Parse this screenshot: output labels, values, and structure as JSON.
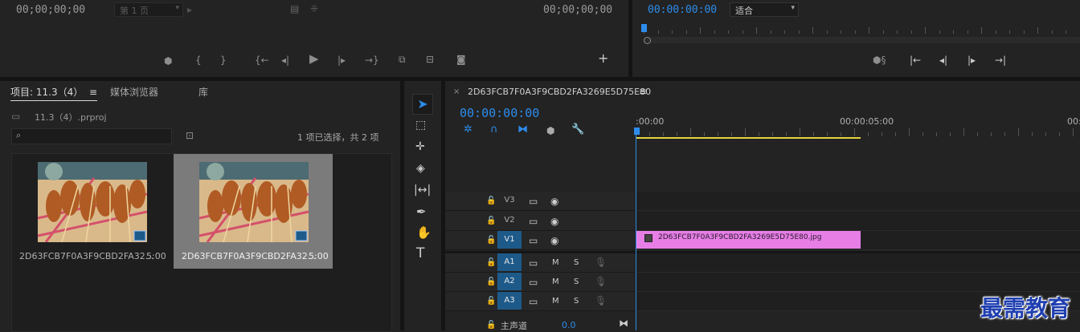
{
  "source_monitor": {
    "timecode_left": "00;00;00;00",
    "page_select": "第 1 页",
    "timecode_right": "00;00;00;00"
  },
  "program_monitor": {
    "timecode": "00:00:00:00",
    "fit_select": "适合"
  },
  "project_panel": {
    "tabs": [
      "项目: 11.3（4）",
      "媒体浏览器",
      "库"
    ],
    "project_file": "11.3（4）.prproj",
    "search_placeholder": "",
    "selection_status": "1 项已选择，共 2 项",
    "items": [
      {
        "name": "2D63FCB7F0A3F9CBD2FA32...",
        "duration": "5:00"
      },
      {
        "name": "2D63FCB7F0A3F9CBD2FA32...",
        "duration": "5:00"
      }
    ]
  },
  "timeline": {
    "sequence_name": "2D63FCB7F0A3F9CBD2FA3269E5D75E80",
    "timecode": "00:00:00:00",
    "ruler_labels": [
      ":00:00",
      "00:00:05:00",
      "00:"
    ],
    "video_tracks": [
      "V3",
      "V2",
      "V1"
    ],
    "audio_tracks": [
      "A1",
      "A2",
      "A3"
    ],
    "mute_label": "M",
    "solo_label": "S",
    "master_label": "主声道",
    "master_value": "0.0",
    "clip_name": "2D63FCB7F0A3F9CBD2FA3269E5D75E80.jpg",
    "clip_color": "#e67ee6"
  },
  "watermark": "最需教育"
}
